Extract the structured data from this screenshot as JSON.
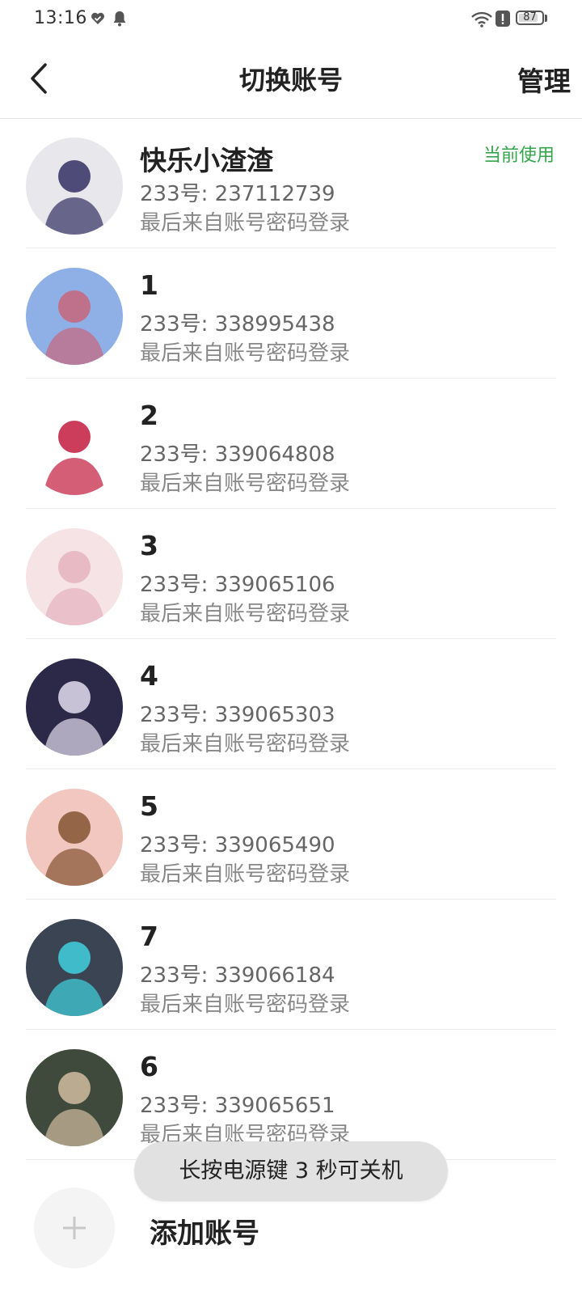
{
  "status_bar": {
    "time": "13:16",
    "battery_level": "87",
    "battery_fraction": 0.87
  },
  "header": {
    "title": "切换账号",
    "manage_label": "管理",
    "back_icon": "chevron-left-icon"
  },
  "accounts": [
    {
      "name": "快乐小渣渣",
      "id_text": "233号: 237112739",
      "login_text": "最后来自账号密码登录",
      "badge": "当前使用",
      "avatar_bg": "#e8e8ec",
      "avatar_fg": "#3d3a6b"
    },
    {
      "name": "1",
      "id_text": "233号: 338995438",
      "login_text": "最后来自账号密码登录",
      "avatar_bg": "#8fb0e6",
      "avatar_fg": "#c46a82"
    },
    {
      "name": "2",
      "id_text": "233号: 339064808",
      "login_text": "最后来自账号密码登录",
      "avatar_bg": "#ffffff",
      "avatar_fg": "#c7284a"
    },
    {
      "name": "3",
      "id_text": "233号: 339065106",
      "login_text": "最后来自账号密码登录",
      "avatar_bg": "#f5e3e6",
      "avatar_fg": "#e6b5c0"
    },
    {
      "name": "4",
      "id_text": "233号: 339065303",
      "login_text": "最后来自账号密码登录",
      "avatar_bg": "#2b2848",
      "avatar_fg": "#d9d3e6"
    },
    {
      "name": "5",
      "id_text": "233号: 339065490",
      "login_text": "最后来自账号密码登录",
      "avatar_bg": "#f1c7bf",
      "avatar_fg": "#8a5a3a"
    },
    {
      "name": "7",
      "id_text": "233号: 339066184",
      "login_text": "最后来自账号密码登录",
      "avatar_bg": "#3b4453",
      "avatar_fg": "#40c9d6"
    },
    {
      "name": "6",
      "id_text": "233号: 339065651",
      "login_text": "最后来自账号密码登录",
      "avatar_bg": "#3f4a3c",
      "avatar_fg": "#c9b79a"
    }
  ],
  "add_account": {
    "label": "添加账号",
    "icon": "plus-icon"
  },
  "toast": {
    "text": "长按电源键 3 秒可关机"
  },
  "colors": {
    "current_badge": "#33a64a",
    "toast_bg": "#e1e1e1"
  }
}
